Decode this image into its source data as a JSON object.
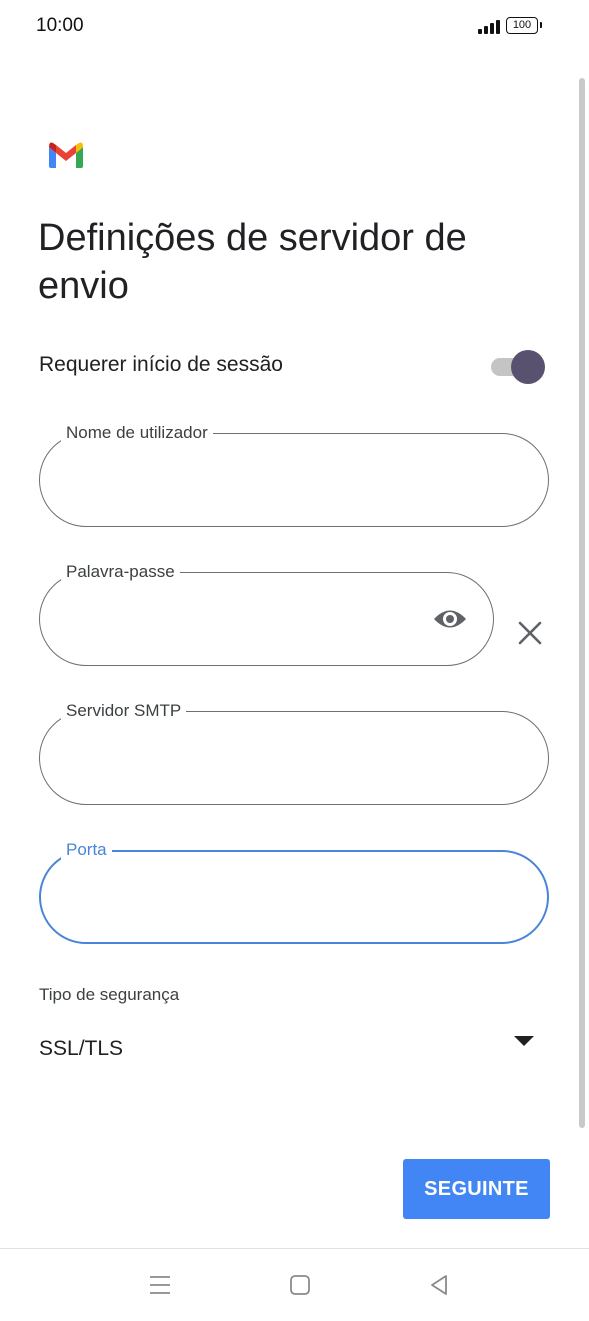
{
  "status_bar": {
    "time": "10:00",
    "battery": "100",
    "signal_icon": "signal-bars-icon"
  },
  "app": {
    "logo": "gmail-logo"
  },
  "page": {
    "title": "Definições de servidor de envio"
  },
  "require_signin": {
    "label": "Requerer início de sessão",
    "enabled": true
  },
  "fields": {
    "username": {
      "label": "Nome de utilizador",
      "value": ""
    },
    "password": {
      "label": "Palavra-passe",
      "value": "",
      "icon": "eye-icon"
    },
    "smtp_server": {
      "label": "Servidor SMTP",
      "value": ""
    },
    "port": {
      "label": "Porta",
      "value": "",
      "focused": true
    }
  },
  "security": {
    "label": "Tipo de segurança",
    "value": "SSL/TLS"
  },
  "actions": {
    "next_label": "SEGUINTE"
  },
  "colors": {
    "accent": "#4285f4",
    "focus": "#4a84d8",
    "toggle_thumb": "#585270"
  },
  "nav": {
    "icons": [
      "recents-icon",
      "home-icon",
      "back-icon"
    ]
  }
}
